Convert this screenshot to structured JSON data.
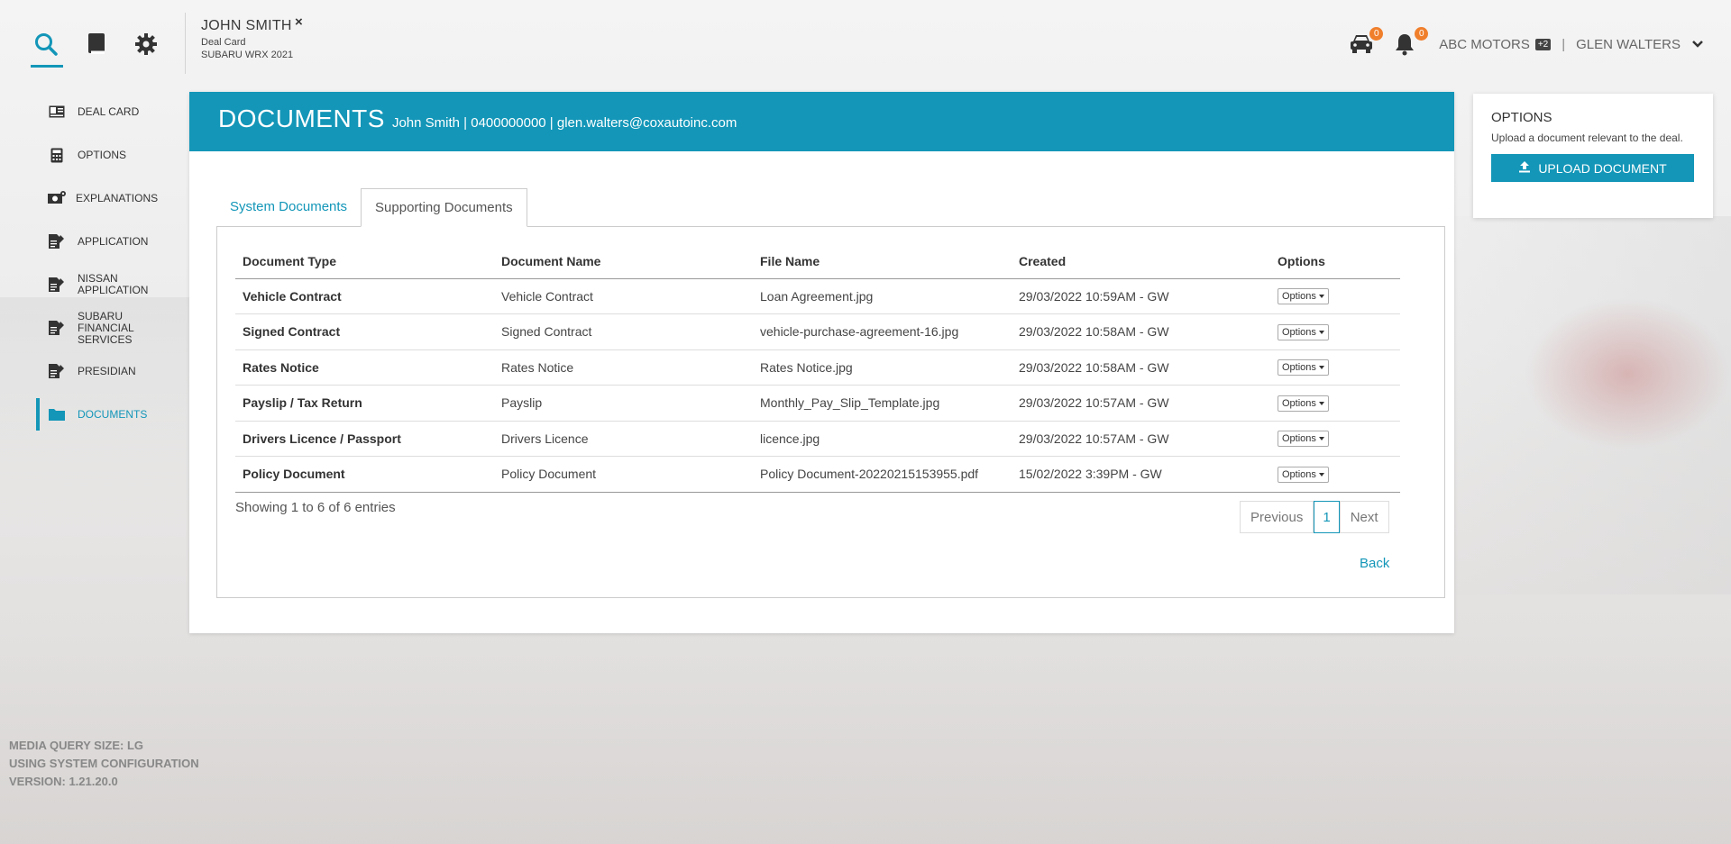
{
  "colors": {
    "accent": "#1396b8",
    "badge": "#f07f2c"
  },
  "header": {
    "icons": [
      "search-icon",
      "book-icon",
      "gear-icon"
    ],
    "deal": {
      "name": "JOHN SMITH",
      "subtitle": "Deal Card",
      "vehicle": "SUBARU WRX 2021",
      "close": "×"
    },
    "car_badge": "0",
    "bell_badge": "0",
    "dealer": "ABC MOTORS",
    "dealer_count": "+2",
    "separator": "|",
    "user": "GLEN WALTERS"
  },
  "sidebar": {
    "items": [
      {
        "label": "DEAL CARD",
        "icon": "id-card-icon"
      },
      {
        "label": "OPTIONS",
        "icon": "calculator-icon"
      },
      {
        "label": "EXPLANATIONS",
        "icon": "money-icon"
      },
      {
        "label": "APPLICATION",
        "icon": "form-icon"
      },
      {
        "label": "NISSAN APPLICATION",
        "icon": "form-icon"
      },
      {
        "label": "SUBARU FINANCIAL SERVICES",
        "icon": "form-icon"
      },
      {
        "label": "PRESIDIAN",
        "icon": "form-icon"
      },
      {
        "label": "DOCUMENTS",
        "icon": "folder-icon",
        "active": true
      }
    ]
  },
  "panel": {
    "title": "DOCUMENTS",
    "meta": "John Smith | 0400000000 | glen.walters@coxautoinc.com",
    "tabs": [
      {
        "label": "System Documents"
      },
      {
        "label": "Supporting Documents",
        "active": true
      }
    ],
    "table": {
      "headers": [
        "Document Type",
        "Document Name",
        "File Name",
        "Created",
        "Options"
      ],
      "rows": [
        {
          "type": "Vehicle Contract",
          "name": "Vehicle Contract",
          "file": "Loan Agreement.jpg",
          "created": "29/03/2022 10:59AM - GW",
          "options": "Options"
        },
        {
          "type": "Signed Contract",
          "name": "Signed Contract",
          "file": "vehicle-purchase-agreement-16.jpg",
          "created": "29/03/2022 10:58AM - GW",
          "options": "Options"
        },
        {
          "type": "Rates Notice",
          "name": "Rates Notice",
          "file": "Rates Notice.jpg",
          "created": "29/03/2022 10:58AM - GW",
          "options": "Options"
        },
        {
          "type": "Payslip / Tax Return",
          "name": "Payslip",
          "file": "Monthly_Pay_Slip_Template.jpg",
          "created": "29/03/2022 10:57AM - GW",
          "options": "Options"
        },
        {
          "type": "Drivers Licence / Passport",
          "name": "Drivers Licence",
          "file": "licence.jpg",
          "created": "29/03/2022 10:57AM - GW",
          "options": "Options"
        },
        {
          "type": "Policy Document",
          "name": "Policy Document",
          "file": "Policy Document-20220215153955.pdf",
          "created": "15/02/2022 3:39PM - GW",
          "options": "Options"
        }
      ]
    },
    "showing": "Showing 1 to 6 of 6 entries",
    "pager": {
      "previous": "Previous",
      "current": "1",
      "next": "Next"
    },
    "back": "Back"
  },
  "options_card": {
    "title": "OPTIONS",
    "description": "Upload a document relevant to the deal.",
    "button": "UPLOAD DOCUMENT"
  },
  "footer": {
    "line1": "MEDIA QUERY SIZE: LG",
    "line2": "USING SYSTEM CONFIGURATION",
    "line3": "VERSION: 1.21.20.0"
  }
}
